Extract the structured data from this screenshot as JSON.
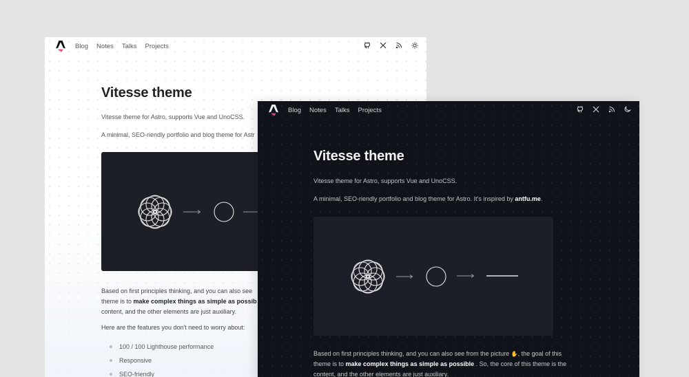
{
  "nav": {
    "links": [
      "Blog",
      "Notes",
      "Talks",
      "Projects"
    ]
  },
  "icons": {
    "logo": "astro-logo",
    "github": "github-icon",
    "x": "x-icon",
    "rss": "rss-icon",
    "light_toggle": "sun-icon",
    "dark_toggle": "moon-icon"
  },
  "light": {
    "title": "Vitesse theme",
    "intro": "Vitesse theme for Astro, supports Vue and UnoCSS.",
    "desc": "A minimal, SEO-riendly portfolio and blog theme for Astr",
    "body_1": "Based on first principles thinking, and you can also see",
    "body_2a": "theme is to ",
    "body_2b": "make complex things as simple as possib",
    "body_3": "content, and the other elements are just auxiliary.",
    "features_intro": "Here are the features you don't need to worry about:",
    "features": [
      "100 / 100 Lighthouse performance",
      "Responsive",
      "SEO-friendly"
    ]
  },
  "dark": {
    "title": "Vitesse theme",
    "intro": "Vitesse theme for Astro, supports Vue and UnoCSS.",
    "desc_prefix": "A minimal, SEO-riendly portfolio and blog theme for Astro. It's inspired by ",
    "desc_link": "antfu.me",
    "desc_suffix": ".",
    "body_1a": "Based on first principles thinking, and you can also see from the picture ",
    "body_1b": ", the goal of this",
    "body_2a": "theme is to ",
    "body_2b": "make complex things as simple as possible",
    "body_2c": " . So, the core of this theme is the",
    "body_3": "content, and the other elements are just auxiliary."
  },
  "colors": {
    "page_bg": "#e4e4e5",
    "dark_bg": "#0f1218",
    "hero_bg": "#1c1f27",
    "logo_accent": "#e5457a"
  }
}
